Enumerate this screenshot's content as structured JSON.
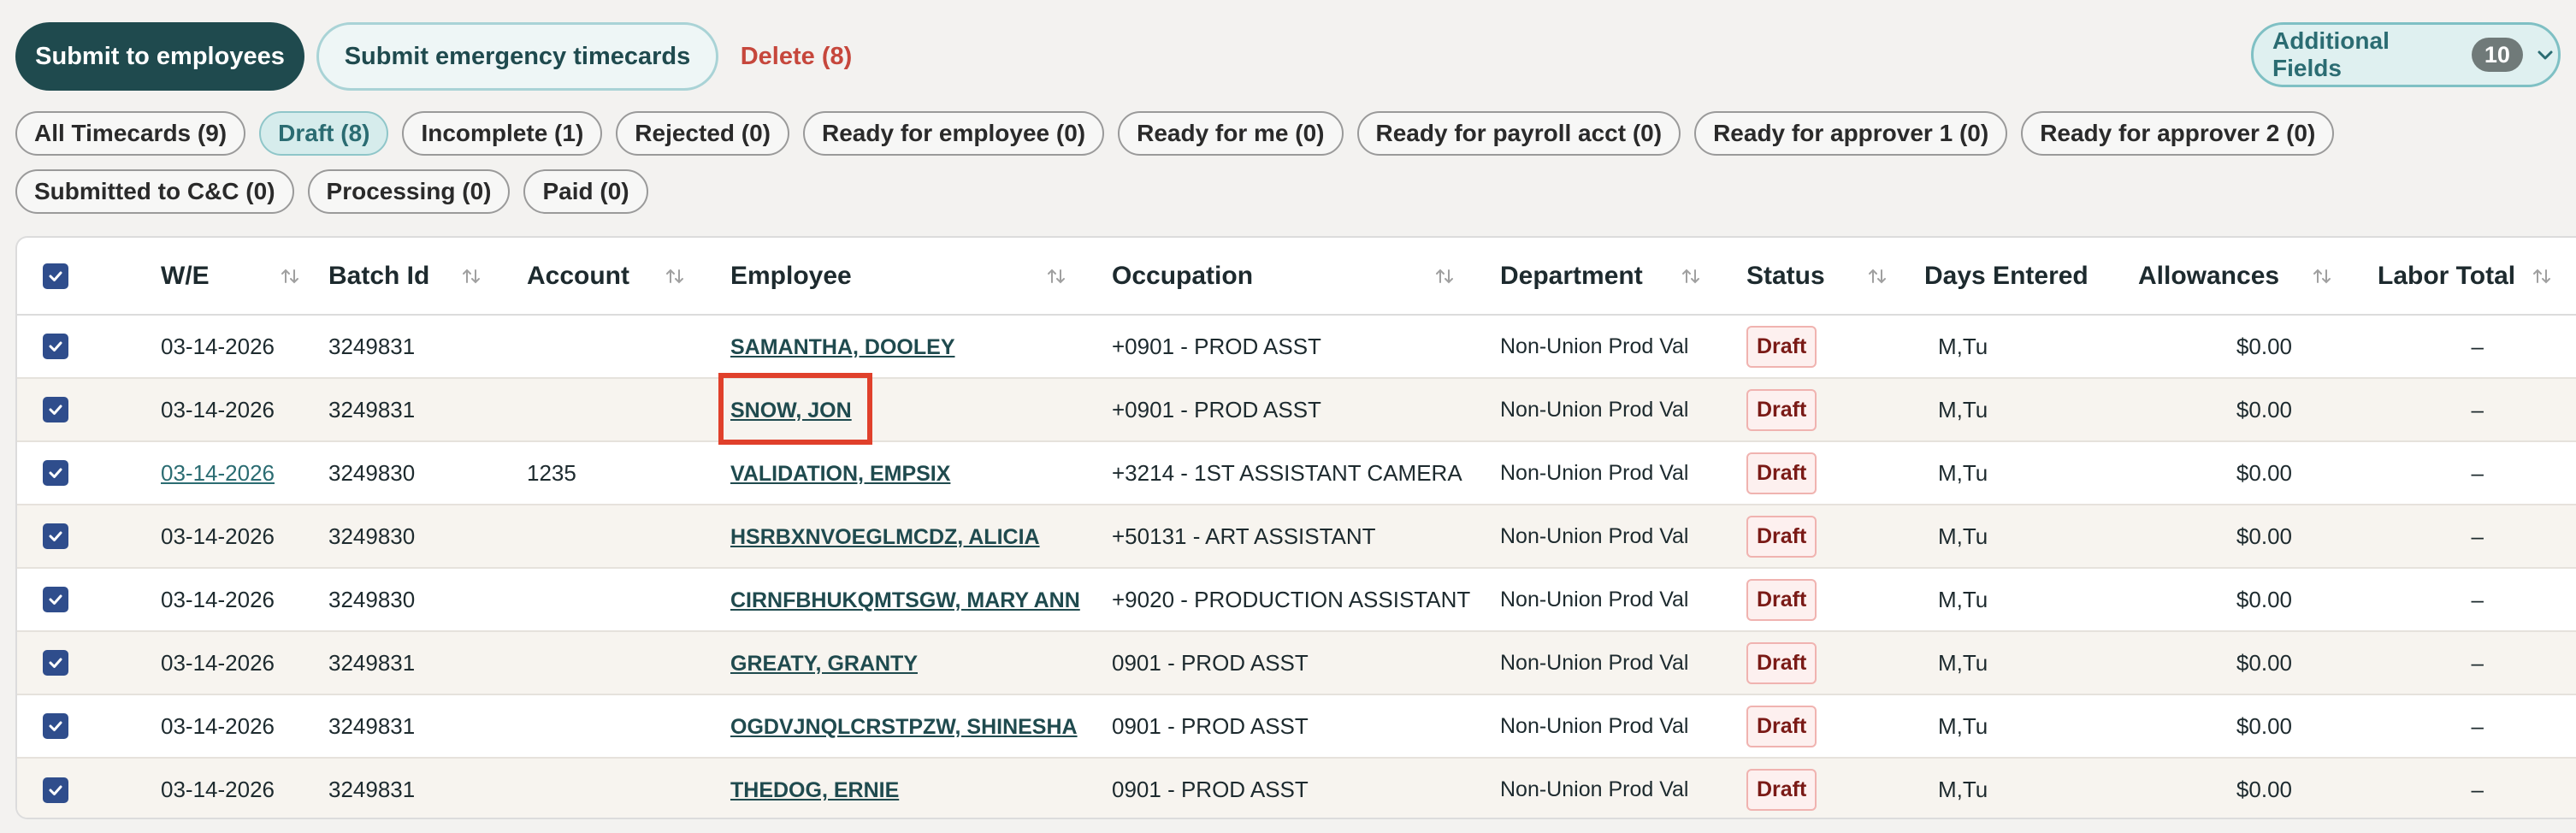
{
  "actions": {
    "submit_employees": "Submit to employees",
    "submit_emergency": "Submit emergency timecards",
    "delete": "Delete (8)",
    "additional_fields": "Additional Fields",
    "additional_fields_count": "10"
  },
  "chips": [
    {
      "label": "All Timecards (9)",
      "active": false
    },
    {
      "label": "Draft (8)",
      "active": true
    },
    {
      "label": "Incomplete (1)",
      "active": false
    },
    {
      "label": "Rejected (0)",
      "active": false
    },
    {
      "label": "Ready for employee (0)",
      "active": false
    },
    {
      "label": "Ready for me (0)",
      "active": false
    },
    {
      "label": "Ready for payroll acct (0)",
      "active": false
    },
    {
      "label": "Ready for approver 1 (0)",
      "active": false
    },
    {
      "label": "Ready for approver 2 (0)",
      "active": false
    },
    {
      "label": "Submitted to C&C (0)",
      "active": false
    },
    {
      "label": "Processing (0)",
      "active": false
    },
    {
      "label": "Paid (0)",
      "active": false
    }
  ],
  "table": {
    "headers": {
      "we": "W/E",
      "batch": "Batch Id",
      "account": "Account",
      "employee": "Employee",
      "occupation": "Occupation",
      "department": "Department",
      "status": "Status",
      "days": "Days Entered",
      "allowances": "Allowances",
      "labor": "Labor Total"
    },
    "rows": [
      {
        "we": "03-14-2026",
        "batch": "3249831",
        "account": "",
        "employee": "SAMANTHA, DOOLEY",
        "occupation": "+0901 - PROD ASST",
        "department": "Non-Union Prod Val",
        "status": "Draft",
        "days": "M,Tu",
        "allowances": "$0.00",
        "labor": "–"
      },
      {
        "we": "03-14-2026",
        "batch": "3249831",
        "account": "",
        "employee": "SNOW, JON",
        "occupation": "+0901 - PROD ASST",
        "department": "Non-Union Prod Val",
        "status": "Draft",
        "days": "M,Tu",
        "allowances": "$0.00",
        "labor": "–"
      },
      {
        "we": "03-14-2026",
        "batch": "3249830",
        "account": "1235",
        "employee": "VALIDATION, EMPSIX",
        "occupation": "+3214 - 1ST ASSISTANT CAMERA",
        "department": "Non-Union Prod Val",
        "status": "Draft",
        "days": "M,Tu",
        "allowances": "$0.00",
        "labor": "–"
      },
      {
        "we": "03-14-2026",
        "batch": "3249830",
        "account": "",
        "employee": "HSRBXNVOEGLMCDZ, ALICIA",
        "occupation": "+50131 - ART ASSISTANT",
        "department": "Non-Union Prod Val",
        "status": "Draft",
        "days": "M,Tu",
        "allowances": "$0.00",
        "labor": "–"
      },
      {
        "we": "03-14-2026",
        "batch": "3249830",
        "account": "",
        "employee": "CIRNFBHUKQMTSGW, MARY ANN",
        "occupation": "+9020 - PRODUCTION ASSISTANT",
        "department": "Non-Union Prod Val",
        "status": "Draft",
        "days": "M,Tu",
        "allowances": "$0.00",
        "labor": "–"
      },
      {
        "we": "03-14-2026",
        "batch": "3249831",
        "account": "",
        "employee": "GREATY, GRANTY",
        "occupation": "0901 - PROD ASST",
        "department": "Non-Union Prod Val",
        "status": "Draft",
        "days": "M,Tu",
        "allowances": "$0.00",
        "labor": "–"
      },
      {
        "we": "03-14-2026",
        "batch": "3249831",
        "account": "",
        "employee": "OGDVJNQLCRSTPZW, SHINESHA",
        "occupation": "0901 - PROD ASST",
        "department": "Non-Union Prod Val",
        "status": "Draft",
        "days": "M,Tu",
        "allowances": "$0.00",
        "labor": "–"
      },
      {
        "we": "03-14-2026",
        "batch": "3249831",
        "account": "",
        "employee": "THEDOG, ERNIE",
        "occupation": "0901 - PROD ASST",
        "department": "Non-Union Prod Val",
        "status": "Draft",
        "days": "M,Tu",
        "allowances": "$0.00",
        "labor": "–"
      }
    ]
  },
  "colors": {
    "primary": "#1f4a4e",
    "accent": "#7fc0c4",
    "delete": "#c6473c",
    "checkbox": "#2f4d8c",
    "draft_badge": "#7a1a16",
    "highlight": "#e0402b"
  }
}
